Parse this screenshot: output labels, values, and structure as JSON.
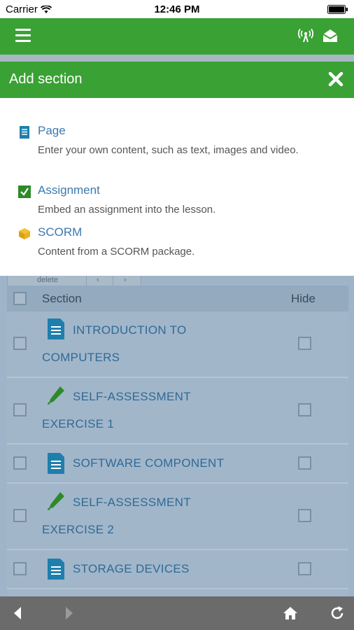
{
  "status_bar": {
    "carrier": "Carrier",
    "time": "12:46 PM"
  },
  "modal": {
    "title": "Add section",
    "options": [
      {
        "name": "Page",
        "description": "Enter your own content, such as text, images and video.",
        "icon": "page-icon"
      },
      {
        "name": "Assignment",
        "description": "Embed an assignment into the lesson.",
        "icon": "checkbox-checked-icon"
      },
      {
        "name": "SCORM",
        "description": "Content from a SCORM package.",
        "icon": "package-cube-icon"
      }
    ]
  },
  "toolbar": {
    "delete_label": "delete",
    "prev_icon": "chevron-left-icon",
    "next_icon": "chevron-right-icon"
  },
  "table": {
    "headers": {
      "section": "Section",
      "hide": "Hide"
    },
    "rows": [
      {
        "line1": "INTRODUCTION TO",
        "line2": "COMPUTERS",
        "icon": "document-icon"
      },
      {
        "line1": "SELF-ASSESSMENT",
        "line2": "EXERCISE 1",
        "icon": "pencil-icon"
      },
      {
        "line1": "SOFTWARE COMPONENT",
        "line2": "",
        "icon": "document-icon"
      },
      {
        "line1": "SELF-ASSESSMENT",
        "line2": "EXERCISE 2",
        "icon": "pencil-icon"
      },
      {
        "line1": "STORAGE DEVICES",
        "line2": "",
        "icon": "document-icon"
      }
    ]
  },
  "colors": {
    "brand_green": "#3aa135",
    "link_blue": "#3c79b0",
    "overlay_blue": "#a2b6ca"
  }
}
